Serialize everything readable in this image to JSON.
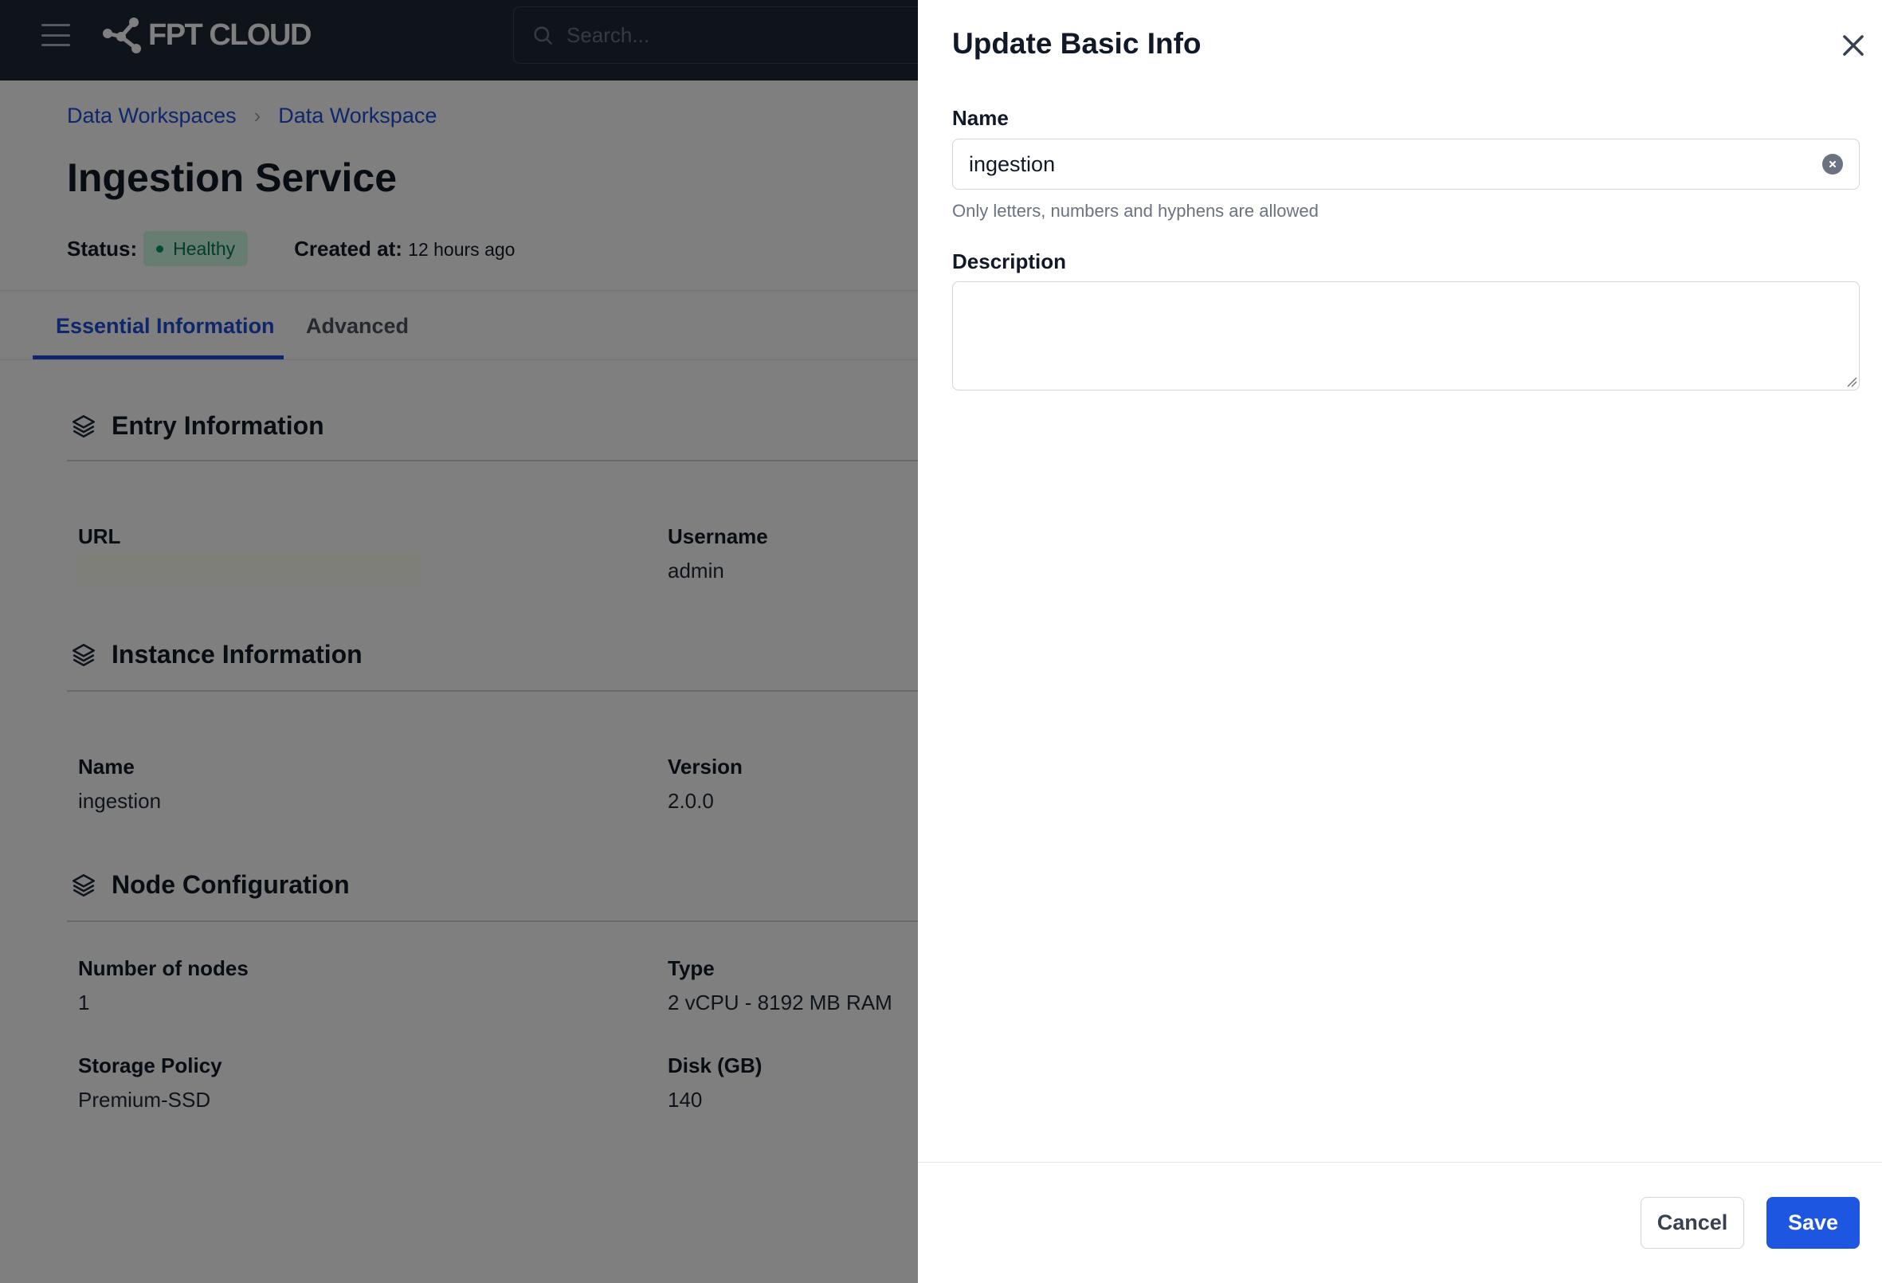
{
  "header": {
    "brand": "FPT CLOUD",
    "search_placeholder": "Search..."
  },
  "breadcrumb": [
    "Data Workspaces",
    "Data Workspace"
  ],
  "page": {
    "title": "Ingestion Service",
    "status_label": "Status:",
    "status_value": "Healthy",
    "created_label": "Created at:",
    "created_value": "12 hours ago"
  },
  "tabs": [
    {
      "label": "Essential Information",
      "active": true
    },
    {
      "label": "Advanced",
      "active": false
    }
  ],
  "sections": {
    "entry": {
      "title": "Entry Information",
      "fields": [
        {
          "label": "URL",
          "value": ""
        },
        {
          "label": "Username",
          "value": "admin"
        }
      ]
    },
    "instance": {
      "title": "Instance Information",
      "fields": [
        {
          "label": "Name",
          "value": "ingestion"
        },
        {
          "label": "Version",
          "value": "2.0.0"
        }
      ]
    },
    "node": {
      "title": "Node Configuration",
      "fields": [
        {
          "label": "Number of nodes",
          "value": "1"
        },
        {
          "label": "Type",
          "value": "2 vCPU - 8192 MB RAM"
        },
        {
          "label": "Storage Policy",
          "value": "Premium-SSD"
        },
        {
          "label": "Disk (GB)",
          "value": "140"
        }
      ]
    }
  },
  "drawer": {
    "title": "Update Basic Info",
    "name_label": "Name",
    "name_value": "ingestion",
    "name_hint": "Only letters, numbers and hyphens are allowed",
    "description_label": "Description",
    "description_value": "",
    "cancel_label": "Cancel",
    "save_label": "Save"
  },
  "colors": {
    "topbar": "#1e2837",
    "accent": "#1d4ed8",
    "save_button": "#1d56e0",
    "status_badge_bg": "#d1fae5",
    "status_text": "#047857"
  },
  "icons": {
    "menu": "hamburger-icon",
    "logo": "fpt-cloud-logo-icon",
    "search": "search-icon",
    "section": "layers-icon",
    "close": "close-icon",
    "clear": "clear-circle-icon"
  }
}
